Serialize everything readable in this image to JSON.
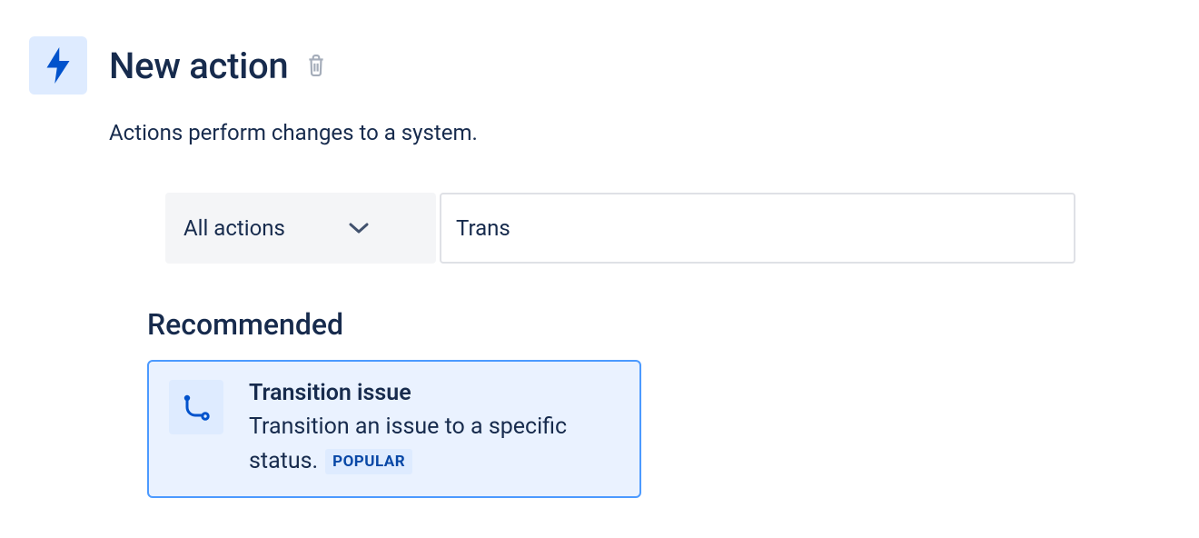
{
  "header": {
    "title": "New action",
    "subtitle": "Actions perform changes to a system."
  },
  "filter": {
    "dropdown_label": "All actions",
    "search_value": "Trans"
  },
  "section": {
    "heading": "Recommended"
  },
  "card": {
    "title": "Transition issue",
    "description": "Transition an issue to a specific status.",
    "badge": "POPULAR"
  }
}
